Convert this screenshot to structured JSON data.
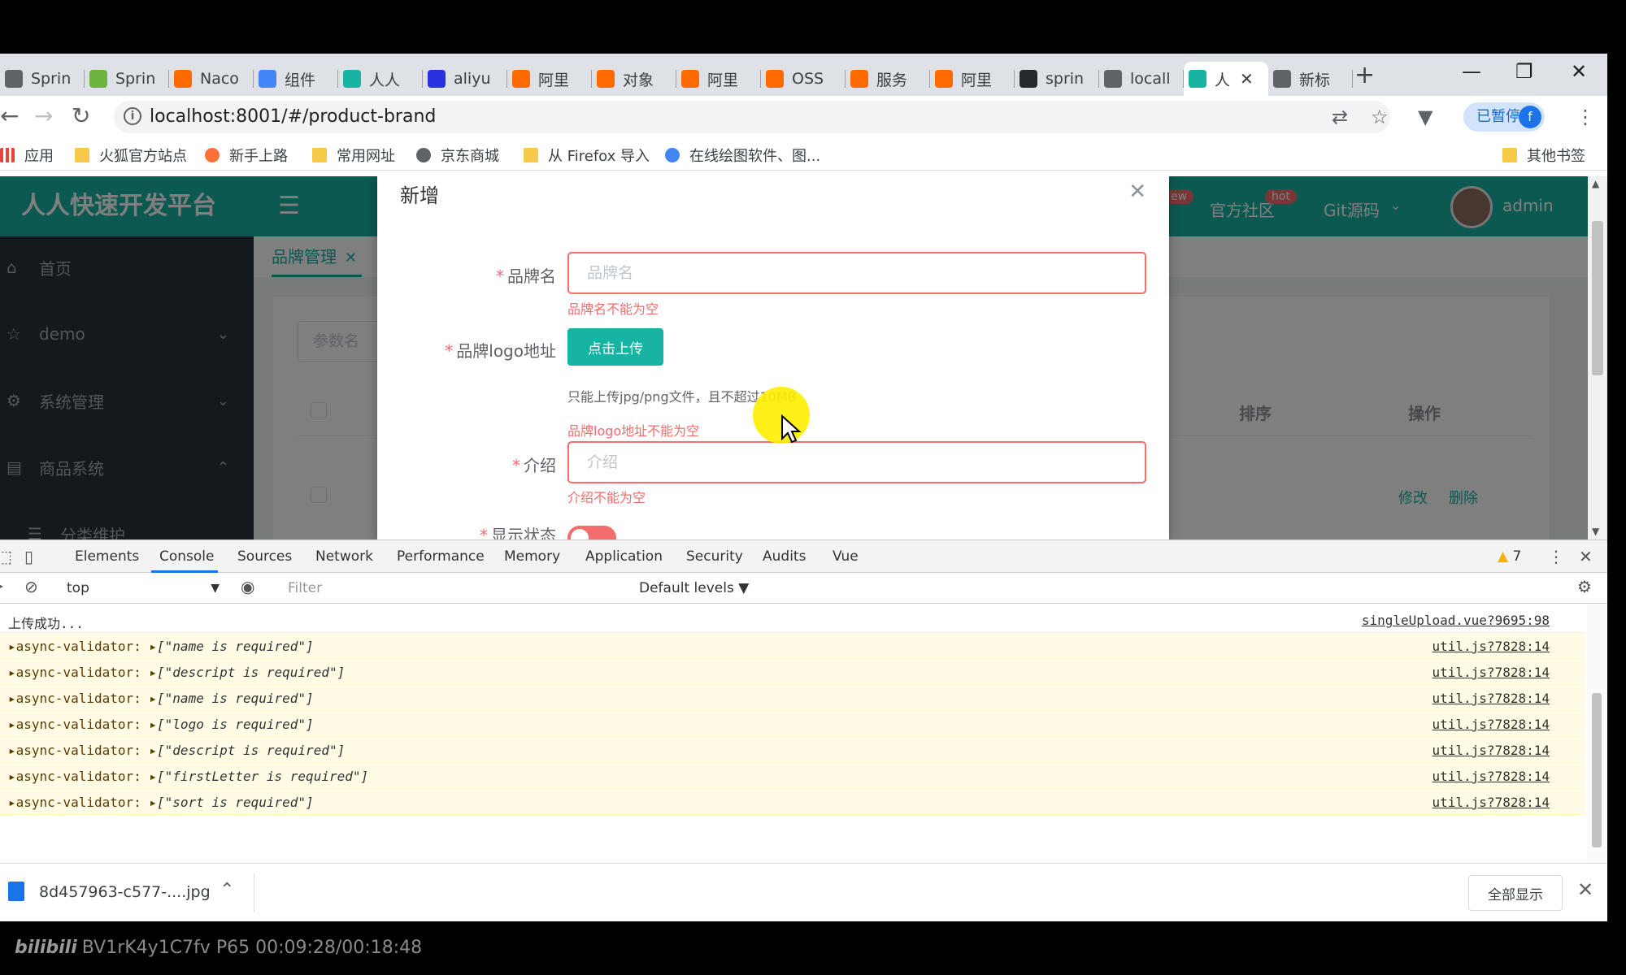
{
  "browser": {
    "tabs": [
      {
        "label": "Sprin",
        "icon": "globe-icon",
        "color": "#5f6368"
      },
      {
        "label": "Sprin",
        "icon": "spring-icon",
        "color": "#6db33f"
      },
      {
        "label": "Naco",
        "icon": "aliyun-icon",
        "color": "#ff6a00"
      },
      {
        "label": "组件",
        "icon": "shield-icon",
        "color": "#4285f4"
      },
      {
        "label": "人人",
        "icon": "renren-icon",
        "color": "#17b3a3"
      },
      {
        "label": "aliyu",
        "icon": "paw-icon",
        "color": "#2932e1"
      },
      {
        "label": "阿里",
        "icon": "aliyun-icon",
        "color": "#ff6a00"
      },
      {
        "label": "对象",
        "icon": "aliyun-icon",
        "color": "#ff6a00"
      },
      {
        "label": "阿里",
        "icon": "aliyun-icon",
        "color": "#ff6a00"
      },
      {
        "label": "OSS",
        "icon": "aliyun-icon",
        "color": "#ff6a00"
      },
      {
        "label": "服务",
        "icon": "aliyun-icon",
        "color": "#ff6a00"
      },
      {
        "label": "阿里",
        "icon": "aliyun-icon",
        "color": "#ff6a00"
      },
      {
        "label": "sprin",
        "icon": "github-icon",
        "color": "#24292e"
      },
      {
        "label": "locall",
        "icon": "globe-icon",
        "color": "#5f6368"
      },
      {
        "label": "人",
        "icon": "renren-icon",
        "color": "#17b3a3",
        "active": true
      },
      {
        "label": "新标",
        "icon": "globe-icon",
        "color": "#5f6368"
      }
    ],
    "new_tab": "+",
    "url": "localhost:8001/#/product-brand",
    "profile_label": "已暂停",
    "profile_initial": "f",
    "bookmarks": [
      {
        "label": "应用",
        "icon": "apps-grid-icon"
      },
      {
        "label": "火狐官方站点",
        "icon": "folder-icon"
      },
      {
        "label": "新手上路",
        "icon": "firefox-icon"
      },
      {
        "label": "常用网址",
        "icon": "folder-icon"
      },
      {
        "label": "京东商城",
        "icon": "globe-icon"
      },
      {
        "label": "从 Firefox 导入",
        "icon": "folder-icon"
      },
      {
        "label": "在线绘图软件、图...",
        "icon": "drawio-icon"
      }
    ],
    "other_bookmarks": "其他书签"
  },
  "app": {
    "brand": "人人快速开发平台",
    "menu": [
      {
        "label": "首页",
        "icon": "home-icon"
      },
      {
        "label": "demo",
        "icon": "star-icon"
      },
      {
        "label": "系统管理",
        "icon": "gear-icon"
      },
      {
        "label": "商品系统",
        "icon": "list-icon"
      },
      {
        "label": "分类维护",
        "icon": "menu-icon"
      }
    ],
    "topnav": {
      "new_badge": "ew",
      "community": "官方社区",
      "hot_badge": "hot",
      "git": "Git源码",
      "username": "admin"
    },
    "open_tab": "品牌管理",
    "search_placeholder": "参数名",
    "table_headers": {
      "sort": "排序",
      "actions": "操作"
    },
    "row_actions": {
      "edit": "修改",
      "delete": "删除"
    }
  },
  "dialog": {
    "title": "新增",
    "fields": {
      "name": {
        "label": "品牌名",
        "placeholder": "品牌名",
        "value": "",
        "error": "品牌名不能为空"
      },
      "logo": {
        "label": "品牌logo地址",
        "button": "点击上传",
        "tip": "只能上传jpg/png文件，且不超过10MB",
        "error": "品牌logo地址不能为空"
      },
      "descript": {
        "label": "介绍",
        "placeholder": "介绍",
        "value": "",
        "error": "介绍不能为空"
      },
      "status": {
        "label": "显示状态"
      }
    }
  },
  "devtools": {
    "tabs": [
      "Elements",
      "Console",
      "Sources",
      "Network",
      "Performance",
      "Memory",
      "Application",
      "Security",
      "Audits",
      "Vue"
    ],
    "active_tab": "Console",
    "warnings_count": "7",
    "context": "top",
    "filter_placeholder": "Filter",
    "levels": "Default levels ▼",
    "messages": [
      {
        "text": "上传成功...",
        "source": "singleUpload.vue?9695:98",
        "level": "info"
      },
      {
        "text": "async-validator:",
        "arg": "[\"name is required\"]",
        "source": "util.js?7828:14",
        "level": "warn"
      },
      {
        "text": "async-validator:",
        "arg": "[\"descript is required\"]",
        "source": "util.js?7828:14",
        "level": "warn"
      },
      {
        "text": "async-validator:",
        "arg": "[\"name is required\"]",
        "source": "util.js?7828:14",
        "level": "warn"
      },
      {
        "text": "async-validator:",
        "arg": "[\"logo is required\"]",
        "source": "util.js?7828:14",
        "level": "warn"
      },
      {
        "text": "async-validator:",
        "arg": "[\"descript is required\"]",
        "source": "util.js?7828:14",
        "level": "warn"
      },
      {
        "text": "async-validator:",
        "arg": "[\"firstLetter is required\"]",
        "source": "util.js?7828:14",
        "level": "warn"
      },
      {
        "text": "async-validator:",
        "arg": "[\"sort is required\"]",
        "source": "util.js?7828:14",
        "level": "warn"
      }
    ]
  },
  "download": {
    "filename": "8d457963-c577-....jpg",
    "show_all": "全部显示"
  },
  "video": {
    "logo": "bilibili",
    "text": "BV1rK4y1C7fv P65 00:09:28/00:18:48"
  },
  "colors": {
    "brand": "#17b3a3",
    "error": "#f56c6c",
    "sidebar": "#263238",
    "warn_bg": "#fffbe5"
  }
}
